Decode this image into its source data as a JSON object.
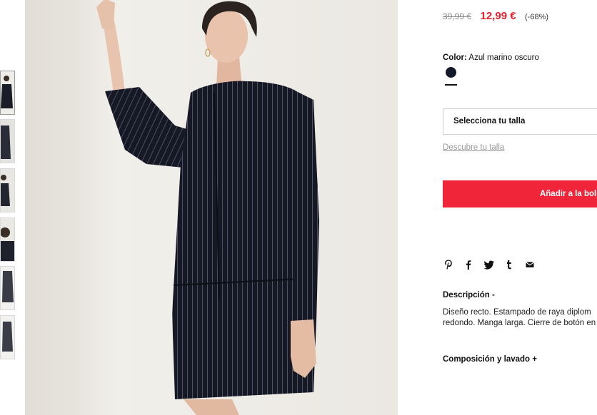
{
  "product": {
    "price_old": "39,99 €",
    "price_new": "12,99 €",
    "discount": "(-68%)",
    "color_label": "Color:",
    "color_value": "Azul marino oscuro",
    "size_placeholder": "Selecciona tu talla",
    "size_guide": "Descubre tu talla",
    "add_to_bag": "Añadir a la bolsa"
  },
  "share": [
    "pinterest-icon",
    "facebook-icon",
    "twitter-icon",
    "tumblr-icon",
    "email-icon"
  ],
  "description": {
    "heading": "Descripción -",
    "line1": "Diseño recto. Estampado de raya diplom",
    "line2": "redondo. Manga larga. Cierre de botón en"
  },
  "composition": {
    "heading": "Composición y lavado +"
  },
  "colors": {
    "accent": "#f0253a",
    "sale_price": "#e8232f",
    "swatch": "#141a2a"
  }
}
